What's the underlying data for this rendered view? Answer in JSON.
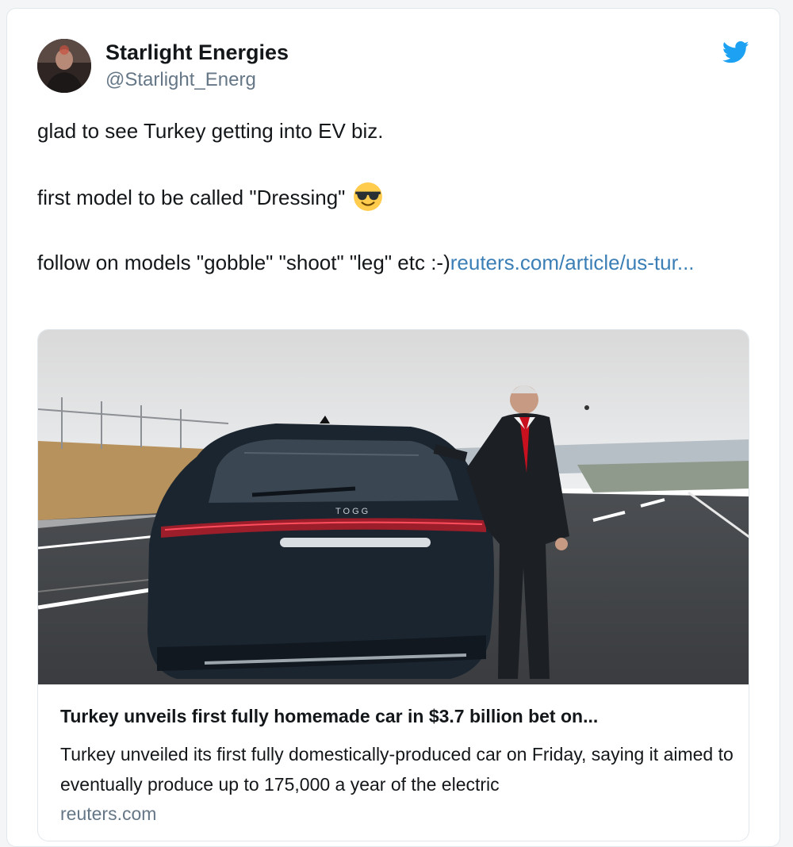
{
  "tweet": {
    "author_name": "Starlight Energies",
    "author_handle": "@Starlight_Energ",
    "paragraphs": {
      "p1": "glad to see Turkey getting into EV biz.",
      "p2": "first model to be called \"Dressing\"",
      "p3": "follow on models \"gobble\" \"shoot\" \"leg\" etc :-)"
    },
    "link_text": "reuters.com/article/us-tur...",
    "emoji": "smiling-face-with-sunglasses",
    "brand_icon": "twitter-bird-icon"
  },
  "link_card": {
    "title": "Turkey unveils first fully homemade car in $3.7 billion bet on...",
    "description": "Turkey unveiled its first fully domestically-produced car on Friday, saying it aimed to eventually produce up to 175,000 a year of the electric",
    "domain": "reuters.com",
    "image_badge": "TOGG"
  },
  "colors": {
    "link": "#3b7fb6",
    "twitter_blue": "#1da1f2",
    "muted_text": "#657786",
    "border": "#e1e8ed"
  }
}
